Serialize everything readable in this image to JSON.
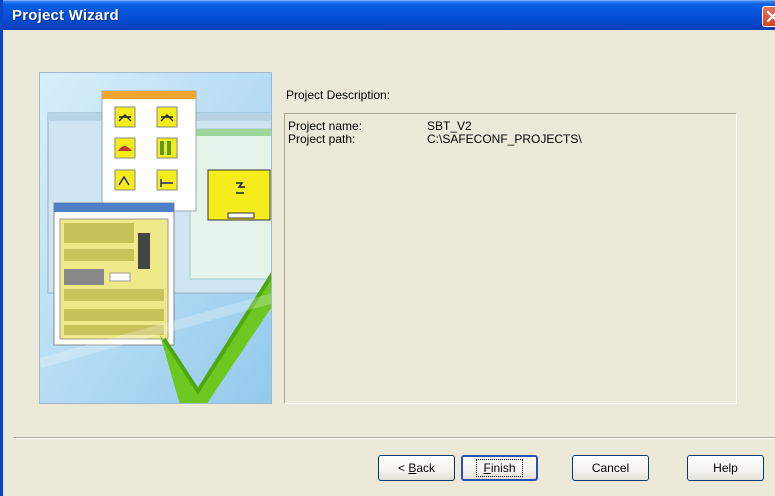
{
  "window": {
    "title": "Project Wizard"
  },
  "description": {
    "heading": "Project Description:",
    "rows": [
      {
        "key": "Project name:",
        "value": "SBT_V2"
      },
      {
        "key": "Project path:",
        "value": "C:\\SAFECONF_PROJECTS\\"
      }
    ]
  },
  "buttons": {
    "back": {
      "prefix": "< ",
      "accel": "B",
      "rest": "ack"
    },
    "finish": {
      "accel": "F",
      "rest": "inish"
    },
    "cancel": "Cancel",
    "help": "Help"
  },
  "colors": {
    "titlebar": "#0653d9",
    "dialog_bg": "#ece9d8",
    "check_green": "#6cc820",
    "panel_yellow": "#f5ec1c"
  }
}
